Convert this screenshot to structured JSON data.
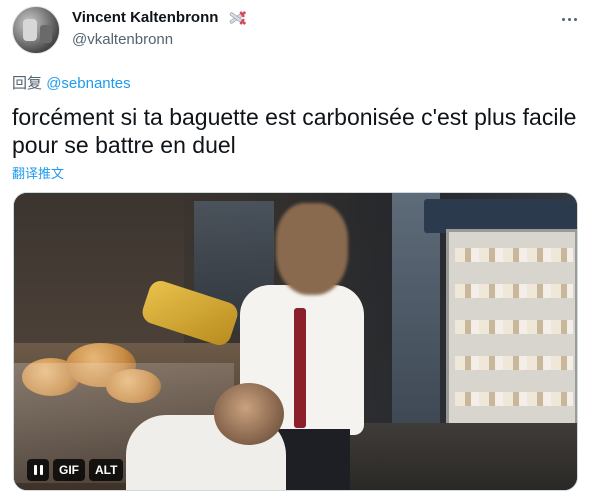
{
  "author": {
    "name": "Vincent Kaltenbronn",
    "handle": "@vkaltenbronn",
    "badge_icon": "sword-emoji-icon"
  },
  "reply": {
    "prefix": "回复",
    "mention": "@sebnantes"
  },
  "tweet": {
    "text": "forcément si ta baguette est carbonisée c'est plus facile pour se battre en duel",
    "translate_label": "翻译推文"
  },
  "media": {
    "type": "gif",
    "controls": {
      "gif_label": "GIF",
      "alt_label": "ALT"
    }
  },
  "colors": {
    "link": "#1d9bf0",
    "secondary_text": "#536471",
    "primary_text": "#0f1419"
  }
}
